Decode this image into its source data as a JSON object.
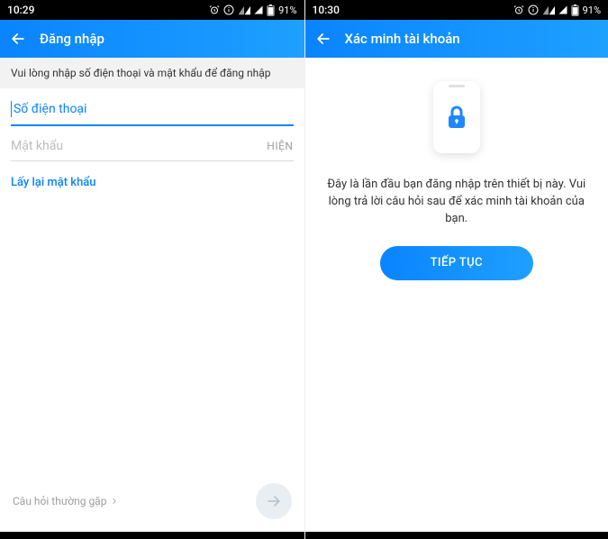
{
  "left": {
    "status": {
      "time": "10:29",
      "battery": "91%"
    },
    "appbar": {
      "title": "Đăng nhập"
    },
    "banner": "Vui lòng nhập số điện thoại và mật khẩu để đăng nhập",
    "phone_placeholder": "Số điện thoại",
    "password_placeholder": "Mật khẩu",
    "show_label": "HIỆN",
    "forgot_label": "Lấy lại mật khẩu",
    "faq_label": "Câu hỏi thường gặp"
  },
  "right": {
    "status": {
      "time": "10:30",
      "battery": "91%"
    },
    "appbar": {
      "title": "Xác minh tài khoản"
    },
    "verify_text": "Đây là lần đầu bạn đăng nhập trên thiết bị này. Vui lòng trả lời câu hỏi sau để xác minh tài khoản của bạn.",
    "continue_label": "TIẾP TỤC"
  }
}
